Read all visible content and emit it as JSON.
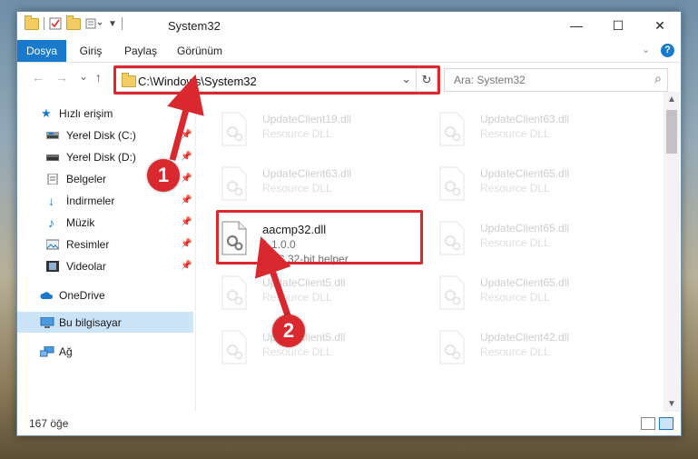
{
  "window": {
    "title": "System32"
  },
  "titlebar_buttons": {
    "minimize": "—",
    "maximize": "☐",
    "close": "✕"
  },
  "ribbon": {
    "tabs": [
      "Dosya",
      "Giriş",
      "Paylaş",
      "Görünüm"
    ],
    "collapse_icon": "chevron-down-icon",
    "help_icon": "help-icon",
    "help_label": "?"
  },
  "address": {
    "path": "C:\\Windows\\System32",
    "dropdown": "⌄",
    "refresh": "↻"
  },
  "search": {
    "placeholder": "Ara: System32",
    "icon": "⌕"
  },
  "nav": {
    "back": "←",
    "forward": "→",
    "recent": "⌄",
    "up": "↑"
  },
  "navpane": {
    "items": [
      {
        "label": "Hızlı erişim",
        "icon": "star-icon",
        "pinned": false
      },
      {
        "label": "Yerel Disk (C:)",
        "icon": "drive-icon",
        "pinned": true
      },
      {
        "label": "Yerel Disk (D:)",
        "icon": "drive-icon",
        "pinned": true
      },
      {
        "label": "Belgeler",
        "icon": "documents-icon",
        "pinned": true
      },
      {
        "label": "İndirmeler",
        "icon": "download-icon",
        "pinned": true
      },
      {
        "label": "Müzik",
        "icon": "music-icon",
        "pinned": true
      },
      {
        "label": "Resimler",
        "icon": "pictures-icon",
        "pinned": true
      },
      {
        "label": "Videolar",
        "icon": "video-icon",
        "pinned": true
      },
      {
        "label": "OneDrive",
        "icon": "cloud-icon",
        "pinned": false
      },
      {
        "label": "Bu bilgisayar",
        "icon": "computer-icon",
        "pinned": false,
        "selected": true
      },
      {
        "label": "Ağ",
        "icon": "network-icon",
        "pinned": false
      }
    ],
    "pin_glyph": "📌"
  },
  "files": [
    {
      "name": "UpdateClient19.dll",
      "sub": "Resource DLL",
      "faded": true
    },
    {
      "name": "UpdateClient63.dll",
      "sub": "Resource DLL",
      "faded": true
    },
    {
      "name": "UpdateClient63.dll",
      "sub": "Resource DLL",
      "faded": true
    },
    {
      "name": "UpdateClient65.dll",
      "sub": "Resource DLL",
      "faded": true
    },
    {
      "name": "aacmp32.dll",
      "version": "1.1.0.0",
      "sub": "AAC 32-bit helper",
      "faded": false
    },
    {
      "name": "UpdateClient65.dll",
      "sub": "Resource DLL",
      "faded": true
    },
    {
      "name": "UpdateClient5.dll",
      "sub": "Resource DLL",
      "faded": true
    },
    {
      "name": "UpdateClient65.dll",
      "sub": "Resource DLL",
      "faded": true
    },
    {
      "name": "UpdateClient5.dll",
      "sub": "Resource DLL",
      "faded": true
    },
    {
      "name": "UpdateClient42.dll",
      "sub": "Resource DLL",
      "faded": true
    }
  ],
  "status": {
    "count": "167 öğe"
  },
  "callouts": [
    "1",
    "2"
  ],
  "colors": {
    "accent": "#1979ca",
    "highlight": "#d9282e",
    "selection": "#cce4f7"
  }
}
